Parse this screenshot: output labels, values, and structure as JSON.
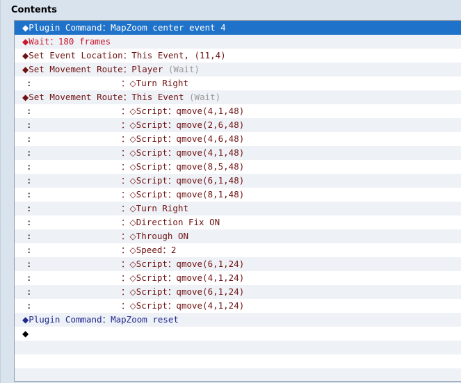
{
  "panel": {
    "title": "Contents"
  },
  "colors": {
    "selection": "#1e72c9",
    "plugin_text": "#1e2a8e",
    "wait_text": "#c8182c",
    "command_text": "#6e1212",
    "note_text": "#9a9a9a"
  },
  "symbols": {
    "filled_diamond": "◆",
    "hollow_diamond": "◇",
    "colon": "：",
    "cont_colon": ":"
  },
  "rows": [
    {
      "type": "cmd",
      "selected": true,
      "cls": "c-plugin",
      "label": "Plugin Command",
      "value": "MapZoom center event 4"
    },
    {
      "type": "cmd",
      "cls": "c-red",
      "label": "Wait",
      "value": "180 frames"
    },
    {
      "type": "cmd",
      "cls": "c-dark",
      "label": "Set Event Location",
      "value": "This Event, (11,4)"
    },
    {
      "type": "cmd",
      "cls": "c-dark",
      "label": "Set Movement Route",
      "value": "Player",
      "note": "(Wait)"
    },
    {
      "type": "sub",
      "text": "Turn Right"
    },
    {
      "type": "cmd",
      "cls": "c-dark",
      "label": "Set Movement Route",
      "value": "This Event",
      "note": "(Wait)"
    },
    {
      "type": "sub",
      "text": "Script",
      "arg": "qmove(4,1,48)"
    },
    {
      "type": "sub",
      "text": "Script",
      "arg": "qmove(2,6,48)"
    },
    {
      "type": "sub",
      "text": "Script",
      "arg": "qmove(4,6,48)"
    },
    {
      "type": "sub",
      "text": "Script",
      "arg": "qmove(4,1,48)"
    },
    {
      "type": "sub",
      "text": "Script",
      "arg": "qmove(8,5,48)"
    },
    {
      "type": "sub",
      "text": "Script",
      "arg": "qmove(6,1,48)"
    },
    {
      "type": "sub",
      "text": "Script",
      "arg": "qmove(8,1,48)"
    },
    {
      "type": "sub",
      "text": "Turn Right"
    },
    {
      "type": "sub",
      "text": "Direction Fix ON"
    },
    {
      "type": "sub",
      "text": "Through ON"
    },
    {
      "type": "sub",
      "text": "Speed",
      "arg": "2"
    },
    {
      "type": "sub",
      "text": "Script",
      "arg": "qmove(6,1,24)"
    },
    {
      "type": "sub",
      "text": "Script",
      "arg": "qmove(4,1,24)"
    },
    {
      "type": "sub",
      "text": "Script",
      "arg": "qmove(6,1,24)"
    },
    {
      "type": "sub",
      "text": "Script",
      "arg": "qmove(4,1,24)"
    },
    {
      "type": "cmd",
      "cls": "c-plugin",
      "label": "Plugin Command",
      "value": "MapZoom reset"
    },
    {
      "type": "end"
    },
    {
      "type": "blank"
    },
    {
      "type": "blank"
    },
    {
      "type": "blank"
    }
  ]
}
